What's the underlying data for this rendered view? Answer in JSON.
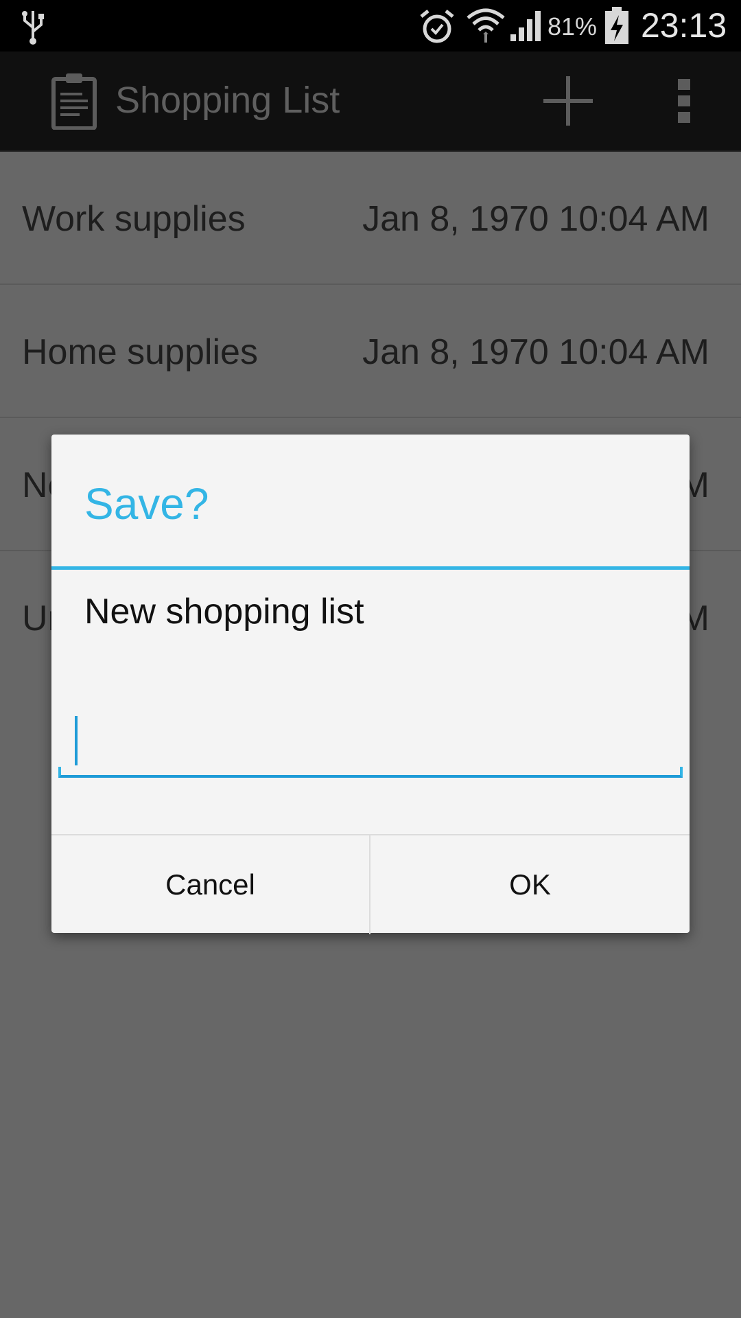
{
  "status_bar": {
    "battery_percent": "81%",
    "time": "23:13",
    "icons": [
      "usb-icon",
      "alarm-icon",
      "wifi-icon",
      "signal-icon",
      "battery-charging-icon"
    ]
  },
  "action_bar": {
    "title": "Shopping List",
    "icons": [
      "clipboard-icon",
      "add-icon",
      "overflow-menu-icon"
    ]
  },
  "list": {
    "rows": [
      {
        "name": "Work supplies",
        "date": "Jan 8, 1970 10:04 AM"
      },
      {
        "name": "Home supplies",
        "date": "Jan 8, 1970 10:04 AM"
      },
      {
        "name": "Ne",
        "date": "M"
      },
      {
        "name": "Ur",
        "date": "M"
      }
    ]
  },
  "dialog": {
    "title": "Save?",
    "message": "New shopping list",
    "input_value": "",
    "cancel_label": "Cancel",
    "ok_label": "OK"
  },
  "colors": {
    "accent": "#33b5e5",
    "dim_background": "#676767",
    "dialog_background": "#f4f4f4"
  }
}
